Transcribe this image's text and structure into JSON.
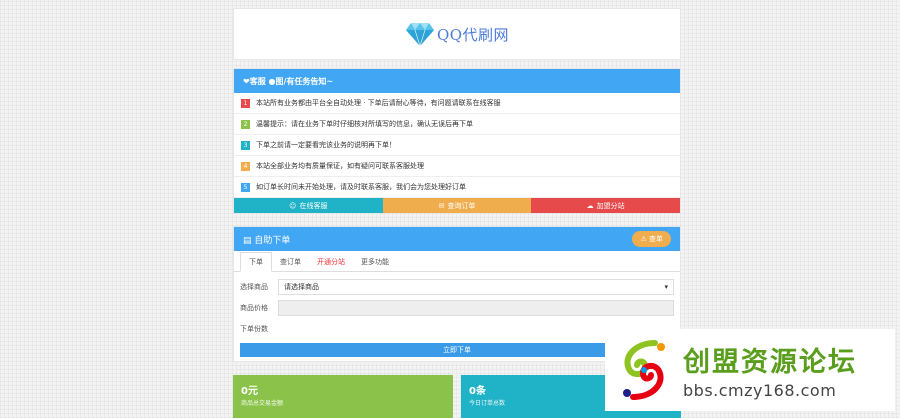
{
  "site": {
    "title": "QQ代刷网"
  },
  "notice": {
    "header": "❤客服 ●图/有任务告知~",
    "items": [
      {
        "n": "1",
        "color": "#e64a4a",
        "text": "本站所有业务都由平台全自动处理 · 下单后请耐心等待，有问题请联系在线客服"
      },
      {
        "n": "2",
        "color": "#8bc34a",
        "text": "温馨提示：请在业务下单时仔细核对所填写的信息，确认无误后再下单"
      },
      {
        "n": "3",
        "color": "#20b2c6",
        "text": "下单之前请一定要看完该业务的说明再下单！"
      },
      {
        "n": "4",
        "color": "#f0ad4e",
        "text": "本站全部业务均有质量保证，如有疑问可联系客服处理"
      },
      {
        "n": "5",
        "color": "#41a6f4",
        "text": "如订单长时间未开始处理，请及时联系客服，我们会为您处理好订单"
      }
    ],
    "buttons": [
      {
        "label": "在线客服",
        "color": "#20b2c6"
      },
      {
        "label": "查询订单",
        "color": "#f0ad4e"
      },
      {
        "label": "加盟分站",
        "color": "#e64a4a"
      }
    ]
  },
  "order": {
    "header": "自助下单",
    "query_button": "查单",
    "tabs": [
      "下单",
      "查订单",
      "开通分站",
      "更多功能"
    ],
    "fields": {
      "category_label": "选择商品",
      "category_value": "请选择商品",
      "price_label": "商品价格",
      "price_value": "",
      "qty_label": "下单份数"
    },
    "submit_label": "立即下单"
  },
  "stats": [
    {
      "value": "0元",
      "label": "商品总交易金额",
      "color": "#8bc34a"
    },
    {
      "value": "0条",
      "label": "今日订单总数",
      "color": "#20b2c6"
    }
  ],
  "watermark": {
    "title": "创盟资源论坛",
    "url": "bbs.cmzy168.com"
  }
}
